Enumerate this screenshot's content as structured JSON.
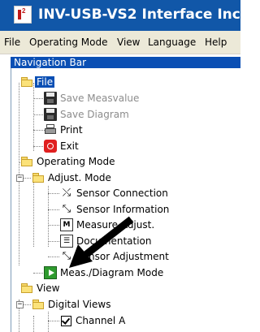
{
  "window": {
    "title": "INV-USB-VS2 Interface Inc."
  },
  "menu": {
    "items": [
      "File",
      "Operating Mode",
      "View",
      "Language",
      "Help"
    ]
  },
  "navigation_bar": {
    "title": "Navigation Bar"
  },
  "tree": {
    "file": {
      "label": "File",
      "children": [
        "Save Measvalue",
        "Save Diagram",
        "Print",
        "Exit"
      ]
    },
    "operating_mode": {
      "label": "Operating Mode",
      "adjust_mode": {
        "label": "Adjust. Mode",
        "children": [
          "Sensor Connection",
          "Sensor Information",
          "Measure Adjust.",
          "Documentation",
          "Sensor Adjustment"
        ]
      },
      "meas_diagram": "Meas./Diagram Mode"
    },
    "view": {
      "label": "View",
      "digital_views": {
        "label": "Digital Views",
        "children": [
          "Channel A"
        ]
      }
    }
  },
  "icons": {
    "folder": "folder-icon",
    "save": "floppy-disk-icon",
    "print": "printer-icon",
    "exit": "exit-icon",
    "sensor": "sensor-icon",
    "measure": "measure-icon",
    "doc": "document-icon",
    "play": "play-icon",
    "checkbox": "checkbox-icon",
    "annotation_arrow": "arrow-pointer"
  },
  "colors": {
    "titlebar": "#1157a8",
    "selection": "#0a4fb4",
    "menu_bg": "#ece9d8",
    "disabled_text": "#8c8c8c",
    "play_green": "#2e9b2e",
    "exit_red": "#e02020"
  }
}
